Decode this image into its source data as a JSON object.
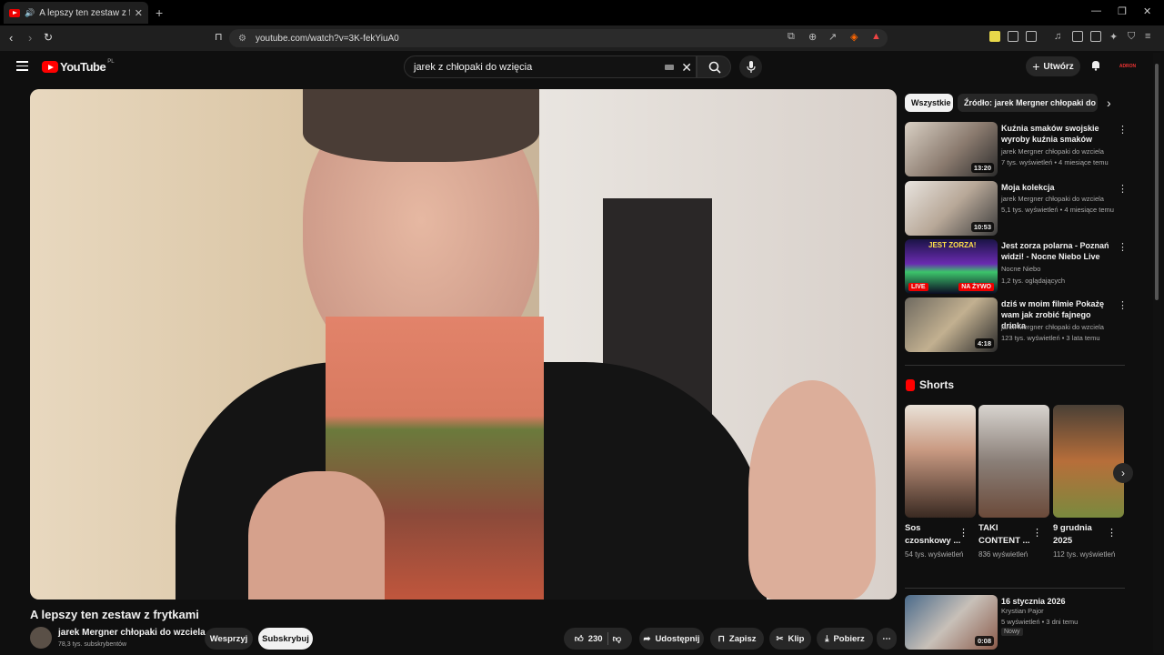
{
  "browser": {
    "tab_title": "A lepszy ten zestaw z frytkami",
    "url": "youtube.com/watch?v=3K-fekYiuA0"
  },
  "header": {
    "logo": "YouTube",
    "region": "PL",
    "search_query": "jarek z chłopaki do wzięcia",
    "create_label": "Utwórz",
    "avatar_text": "ADRON"
  },
  "video": {
    "title": "A lepszy ten zestaw z frytkami",
    "channel": "jarek Mergner chłopaki do wzciela",
    "subscribers": "78,3 tys. subskrybentów",
    "support_label": "Wesprzyj",
    "subscribe_label": "Subskrybuj",
    "likes": "230",
    "share_label": "Udostępnij",
    "save_label": "Zapisz",
    "clip_label": "Klip",
    "download_label": "Pobierz"
  },
  "chips": [
    "Wszystkie",
    "Źródło: jarek Mergner chłopaki do wzię"
  ],
  "recommendations": [
    {
      "title": "Kuźnia smaków swojskie wyroby kuźnia smaków",
      "channel": "jarek Mergner chłopaki do wzciela",
      "meta": "7 tys. wyświetleń • 4 miesiące temu",
      "duration": "13:20"
    },
    {
      "title": "Moja kolekcja",
      "channel": "jarek Mergner chłopaki do wzciela",
      "meta": "5,1 tys. wyświetleń • 4 miesiące temu",
      "duration": "10:53"
    },
    {
      "title": "Jest zorza polarna - Poznań widzi! - Nocne Niebo Live",
      "channel": "Nocne Niebo",
      "meta": "1,2 tys. oglądających",
      "duration": "LIVE",
      "badge": "NA ŻYWO",
      "overlay": "JEST ZORZA!"
    },
    {
      "title": "dziś w moim filmie Pokażę wam jak zrobić fajnego drinka",
      "channel": "jarek Mergner chłopaki do wzciela",
      "meta": "123 tys. wyświetleń • 3 lata temu",
      "duration": "4:18"
    }
  ],
  "shorts": {
    "title": "Shorts",
    "items": [
      {
        "title": "Sos czosnkowy ...",
        "views": "54 tys. wyświetleń"
      },
      {
        "title": "TAKI CONTENT ...",
        "views": "836 wyświetleń"
      },
      {
        "title": "9 grudnia 2025",
        "views": "112 tys. wyświetleń"
      }
    ]
  },
  "last_rec": {
    "title": "16 stycznia 2026",
    "channel": "Krystian Pajor",
    "meta": "5 wyświetleń • 3 dni temu",
    "badge": "Nowy",
    "duration": "0:08"
  },
  "colors": {
    "accent": "#ff0000",
    "background": "#0f0f0f"
  }
}
